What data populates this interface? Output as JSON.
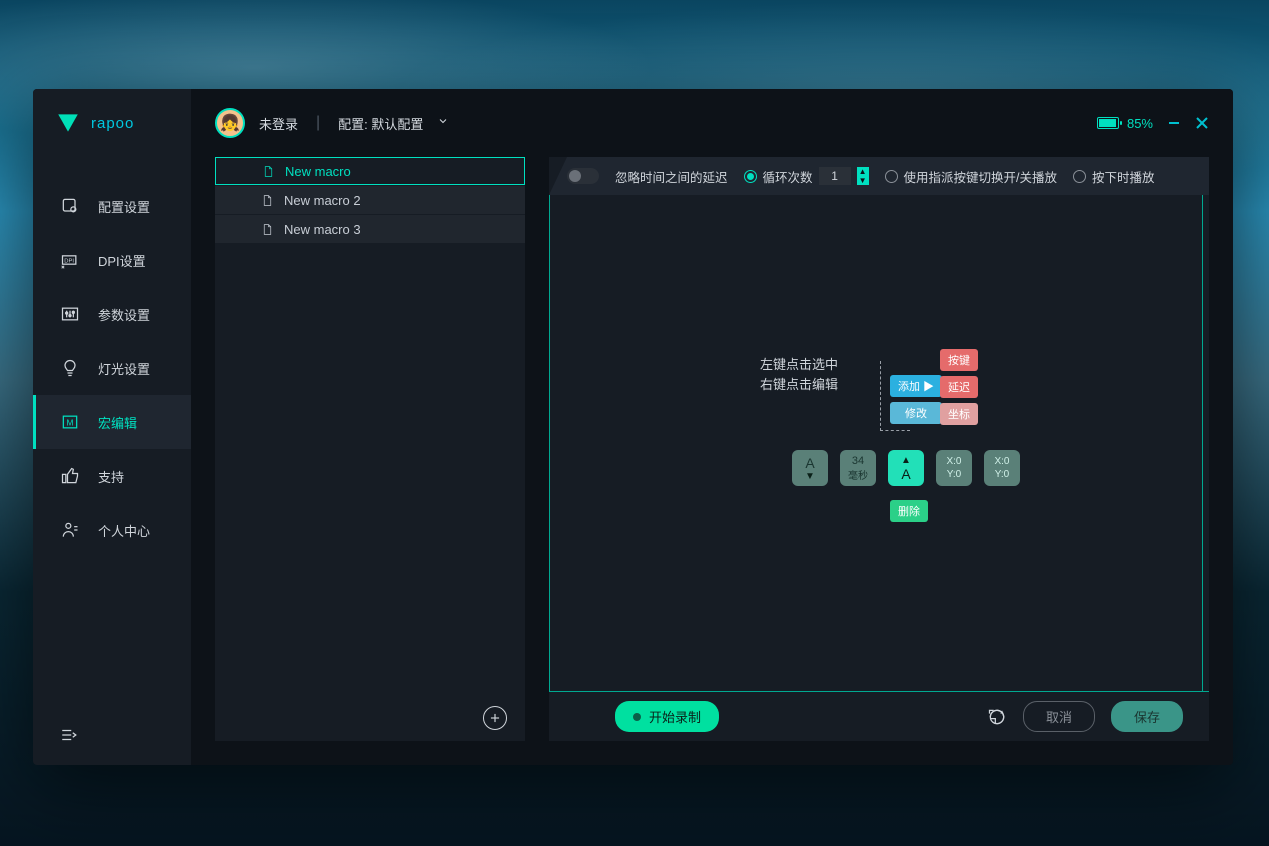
{
  "brand": {
    "name": "rapoo"
  },
  "header": {
    "login_status": "未登录",
    "config_label": "配置: 默认配置",
    "battery_percent": "85%"
  },
  "sidebar": {
    "items": [
      {
        "label": "配置设置",
        "icon": "config"
      },
      {
        "label": "DPI设置",
        "icon": "dpi"
      },
      {
        "label": "参数设置",
        "icon": "params"
      },
      {
        "label": "灯光设置",
        "icon": "light"
      },
      {
        "label": "宏编辑",
        "icon": "macro",
        "active": true
      },
      {
        "label": "支持",
        "icon": "support"
      },
      {
        "label": "个人中心",
        "icon": "user"
      }
    ]
  },
  "macros": {
    "items": [
      {
        "name": "New macro",
        "active": true
      },
      {
        "name": "New macro 2"
      },
      {
        "name": "New macro 3"
      }
    ]
  },
  "editor_options": {
    "ignore_delay_label": "忽略时间之间的延迟",
    "loop_label": "循环次数",
    "loop_count": "1",
    "toggle_key_label": "使用指派按键切换开/关播放",
    "play_on_press_label": "按下时播放"
  },
  "hints": {
    "line1": "左键点击选中",
    "line2": "右键点击编辑"
  },
  "context_menu": {
    "add": "添加 ▶",
    "edit": "修改",
    "key": "按键",
    "delay": "延迟",
    "coord": "坐标",
    "delete": "删除"
  },
  "sequence": {
    "keydown_label": "A",
    "delay_value": "34",
    "delay_unit": "毫秒",
    "keyup_label": "A",
    "coord1_x": "X:0",
    "coord1_y": "Y:0",
    "coord2_x": "X:0",
    "coord2_y": "Y:0"
  },
  "footer": {
    "record": "开始录制",
    "cancel": "取消",
    "save": "保存"
  }
}
